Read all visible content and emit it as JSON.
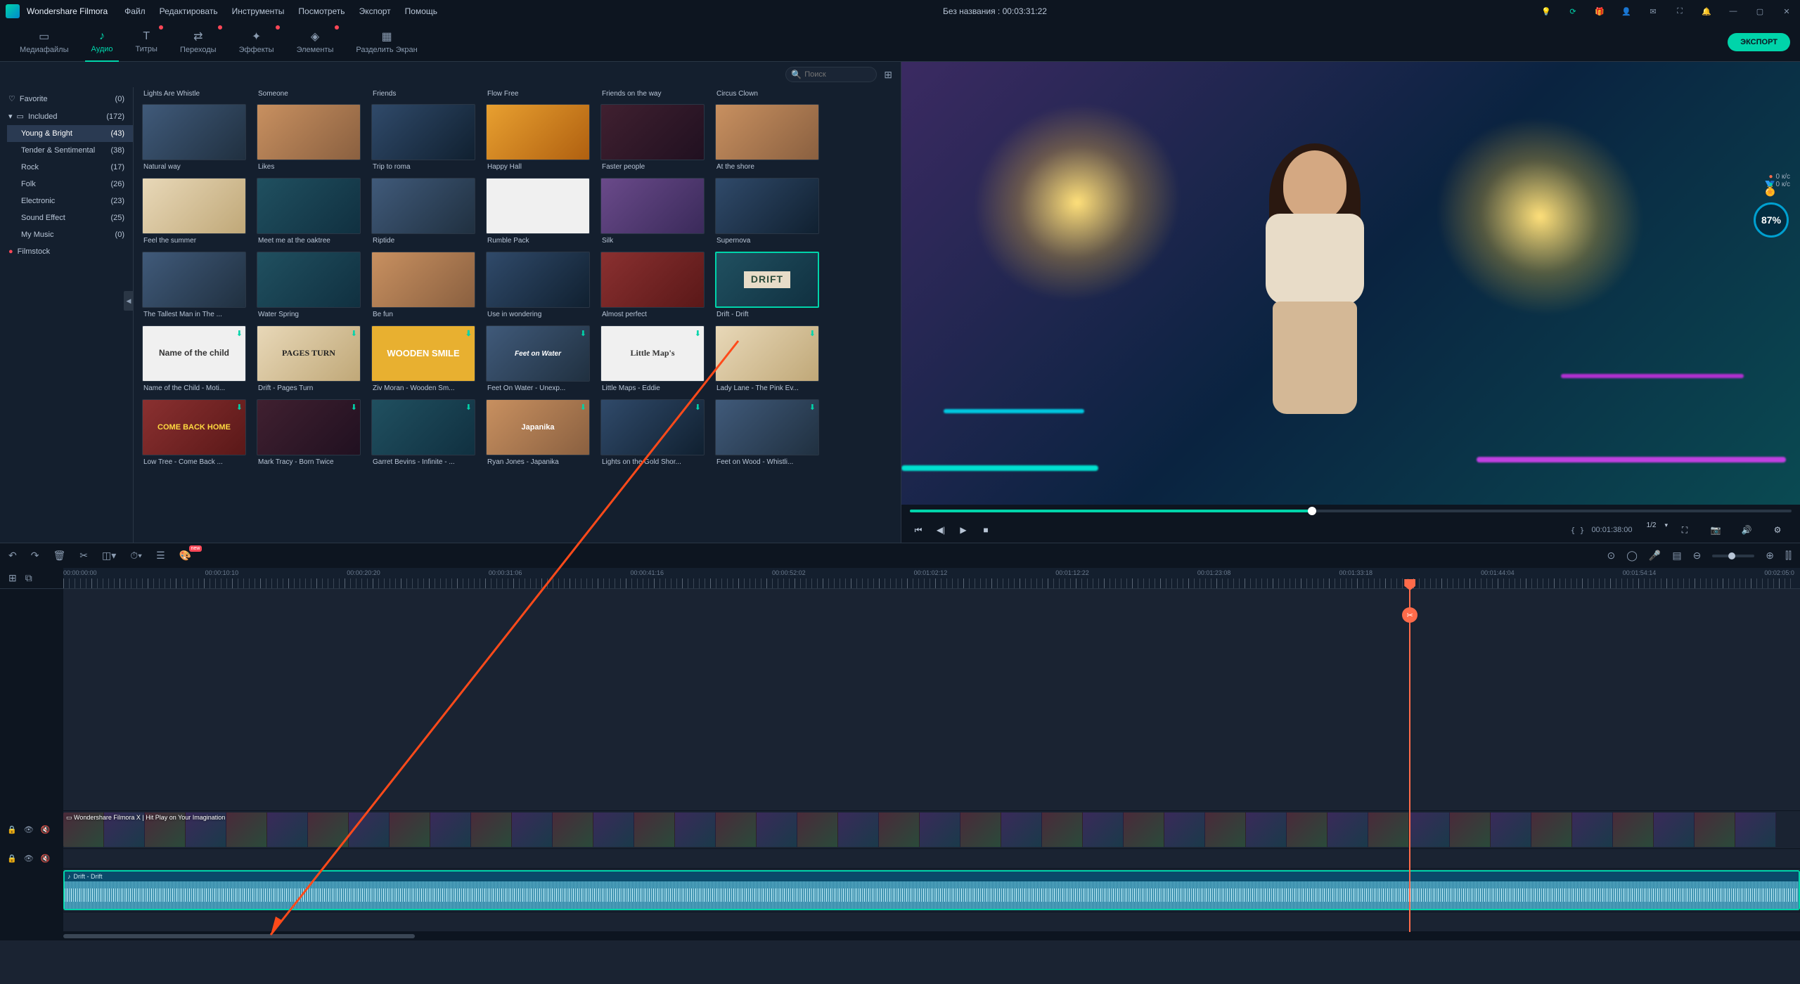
{
  "app": {
    "name": "Wondershare Filmora",
    "project_title": "Без названия : 00:03:31:22"
  },
  "menu": [
    "Файл",
    "Редактировать",
    "Инструменты",
    "Посмотреть",
    "Экспорт",
    "Помощь"
  ],
  "tabs": [
    {
      "label": "Медиафайлы",
      "icon": "📁"
    },
    {
      "label": "Аудио",
      "icon": "♪",
      "active": true
    },
    {
      "label": "Титры",
      "icon": "T",
      "dot": true
    },
    {
      "label": "Переходы",
      "icon": "⇄",
      "dot": true
    },
    {
      "label": "Эффекты",
      "icon": "✦",
      "dot": true
    },
    {
      "label": "Элементы",
      "icon": "◈",
      "dot": true
    },
    {
      "label": "Разделить Экран",
      "icon": "▦"
    }
  ],
  "export_label": "ЭКСПОРТ",
  "search": {
    "placeholder": "Поиск"
  },
  "sidebar": {
    "favorite": {
      "label": "Favorite",
      "count": "(0)"
    },
    "included": {
      "label": "Included",
      "count": "(172)"
    },
    "items": [
      {
        "label": "Young & Bright",
        "count": "(43)",
        "sel": true
      },
      {
        "label": "Tender & Sentimental",
        "count": "(38)"
      },
      {
        "label": "Rock",
        "count": "(17)"
      },
      {
        "label": "Folk",
        "count": "(26)"
      },
      {
        "label": "Electronic",
        "count": "(23)"
      },
      {
        "label": "Sound Effect",
        "count": "(25)"
      },
      {
        "label": "My Music",
        "count": "(0)"
      }
    ],
    "filmstock": "Filmstock"
  },
  "asset_header": [
    "Lights Are Whistle",
    "Someone",
    "Friends",
    "Flow Free",
    "Friends on the way",
    "Circus Clown"
  ],
  "assets": [
    [
      "Natural way",
      "Likes",
      "Trip to roma",
      "Happy Hall",
      "Faster people",
      "At the shore"
    ],
    [
      "Feel the summer",
      "Meet me at the oaktree",
      "Riptide",
      "Rumble Pack",
      "Silk",
      "Supernova"
    ],
    [
      "The Tallest Man in The ...",
      "Water Spring",
      "Be fun",
      "Use in wondering",
      "Almost perfect",
      "Drift - Drift"
    ],
    [
      "Name of the Child - Moti...",
      "Drift - Pages Turn",
      "Ziv Moran - Wooden Sm...",
      "Feet On Water - Unexp...",
      "Little Maps - Eddie",
      "Lady Lane - The Pink Ev..."
    ],
    [
      "Low Tree - Come Back ...",
      "Mark Tracy - Born Twice",
      "Garret Bevins - Infinite - ...",
      "Ryan Jones - Japanika",
      "Lights on the Gold Shor...",
      "Feet on Wood - Whistli..."
    ]
  ],
  "thumb_text": {
    "r3c0": "Name of the child",
    "r3c1": "PAGES TURN",
    "r3c2": "WOODEN SMILE",
    "r3c3": "Feet on Water",
    "r3c4": "Little Map's",
    "r3c5": " ",
    "r4c0": "COME BACK HOME",
    "r4c3": "Japanika",
    "r2c5_badge": "DRIFT"
  },
  "preview": {
    "badge_pct": "87%",
    "stat1": "0 к/с",
    "stat2": "0 к/с",
    "time_brackets": "{    }",
    "duration": "00:01:38:00",
    "frame_ratio": "1/2"
  },
  "ruler": [
    "00:00:00:00",
    "00:00:10:10",
    "00:00:20:20",
    "00:00:31:06",
    "00:00:41:16",
    "00:00:52:02",
    "00:01:02:12",
    "00:01:12:22",
    "00:01:23:08",
    "00:01:33:18",
    "00:01:44:04",
    "00:01:54:14",
    "00:02:05:0"
  ],
  "timeline": {
    "video_clip_label": "Wondershare Filmora X | Hit Play on Your Imagination",
    "audio_clip_label": "Drift - Drift",
    "new_badge": "new"
  },
  "playhead_pct": 77.5
}
